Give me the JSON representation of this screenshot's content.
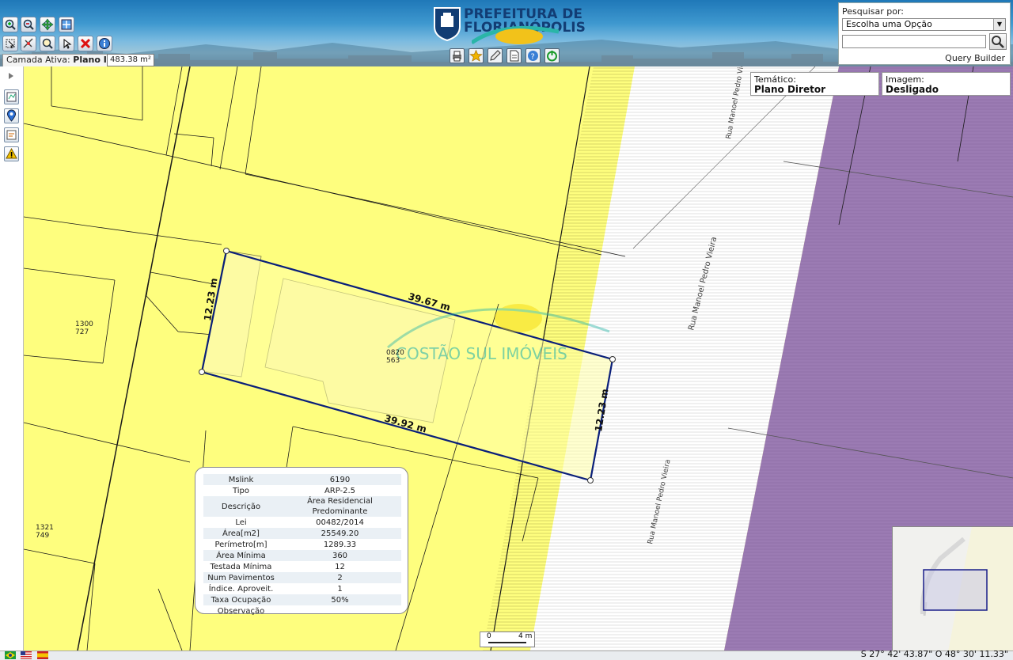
{
  "header": {
    "logo_line1": "PREFEITURA DE",
    "logo_line2": "FLORIANÓPOLIS",
    "active_layer_label": "Camada Ativa:",
    "active_layer_value": "Plano I",
    "area_tooltip": "483.38 m²"
  },
  "toolbar_icons": [
    "zoom-in-icon",
    "zoom-out-icon",
    "pan-icon",
    "full-extent-icon",
    "select-icon",
    "measure-icon",
    "zoom-window-icon",
    "pointer-icon",
    "clear-icon",
    "info-icon"
  ],
  "search": {
    "label": "Pesquisar por:",
    "selected_option": "Escolha uma Opção",
    "input_value": "",
    "query_builder": "Query Builder"
  },
  "thematic": {
    "tematico_label": "Temático:",
    "tematico_value": "Plano Diretor",
    "imagem_label": "Imagem:",
    "imagem_value": "Desligado"
  },
  "map": {
    "street_name": "Rua Manoel Pedro Vieira",
    "parcel_labels": [
      {
        "line1": "1300",
        "line2": "727"
      },
      {
        "line1": "0820",
        "line2": "563"
      },
      {
        "line1": "1321",
        "line2": "749"
      }
    ],
    "measurements": {
      "top": "39.67 m",
      "bottom": "39.92 m",
      "left": "12.23 m",
      "right": "12.23 m"
    },
    "watermark": "COSTÃO SUL IMÓVEIS",
    "scale_start": "0",
    "scale_end": "4 m"
  },
  "info": {
    "rows": [
      {
        "key": "Mslink",
        "value": "6190"
      },
      {
        "key": "Tipo",
        "value": "ARP-2.5"
      },
      {
        "key": "Descrição",
        "value": "Área Residencial Predominante"
      },
      {
        "key": "Lei",
        "value": "00482/2014"
      },
      {
        "key": "Área[m2]",
        "value": "25549.20"
      },
      {
        "key": "Perímetro[m]",
        "value": "1289.33"
      },
      {
        "key": "Área Mínima",
        "value": "360"
      },
      {
        "key": "Testada Mínima",
        "value": "12"
      },
      {
        "key": "Num Pavimentos",
        "value": "2"
      },
      {
        "key": "Índice. Aproveit.",
        "value": "1"
      },
      {
        "key": "Taxa Ocupação",
        "value": "50%"
      },
      {
        "key": "Observação",
        "value": ""
      }
    ]
  },
  "status": {
    "coordinates": "S 27° 42' 43.87\" O 48° 30' 11.33\""
  },
  "colors": {
    "zone_yellow": "#fefe7e",
    "zone_purple": "#9b7bb3",
    "selection_outline": "#0a1f7a",
    "header_blue": "#2a82c0"
  }
}
